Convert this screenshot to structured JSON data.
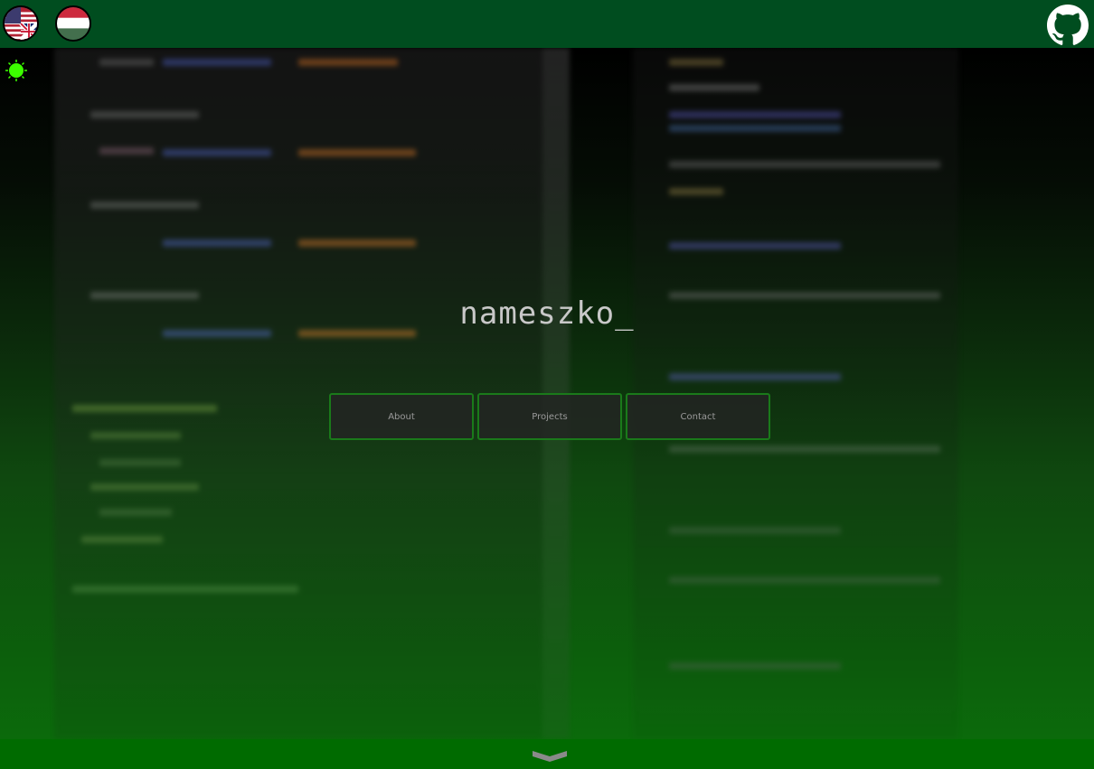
{
  "header": {
    "languages": [
      {
        "code": "en",
        "icon": "us-uk-flag-icon"
      },
      {
        "code": "hu",
        "icon": "hungary-flag-icon"
      }
    ],
    "github_icon": "github-icon"
  },
  "theme_toggle": {
    "icon": "sun-icon",
    "color": "#3cff00"
  },
  "hero": {
    "title": "nameszko_"
  },
  "nav": {
    "about": "About",
    "projects": "Projects",
    "contact": "Contact"
  },
  "footer": {
    "scroll_icon": "chevron-down-icon"
  },
  "colors": {
    "header_bg": "#004d1f",
    "footer_bg": "#006b00",
    "button_border": "#1a7a1a",
    "accent": "#3cff00"
  }
}
